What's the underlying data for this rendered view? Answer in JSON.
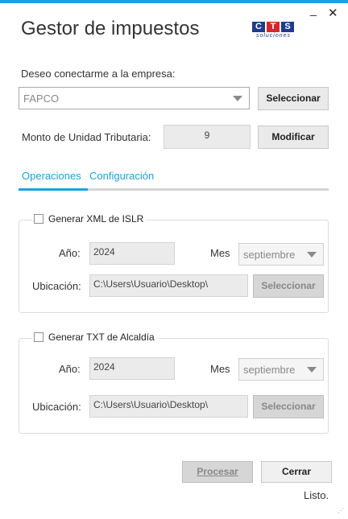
{
  "window": {
    "title": "Gestor de impuestos",
    "minimize_glyph": "_",
    "close_glyph": "✕"
  },
  "logo": {
    "letters": [
      "C",
      "T",
      "S"
    ],
    "tagline": "soluciones"
  },
  "company": {
    "label": "Deseo conectarme a la empresa:",
    "selected": "FAPCO",
    "select_button": "Seleccionar"
  },
  "unit": {
    "label": "Monto de Unidad Tributaria:",
    "value": "9",
    "modify_button": "Modificar"
  },
  "tabs": [
    {
      "label": "Operaciones",
      "active": true
    },
    {
      "label": "Configuración",
      "active": false
    }
  ],
  "xml_group": {
    "title": "Generar XML de ISLR",
    "checked": false,
    "year_label": "Año:",
    "year_value": "2024",
    "month_label": "Mes",
    "month_value": "septiembre",
    "location_label": "Ubicación:",
    "location_value": "C:\\Users\\Usuario\\Desktop\\",
    "select_button": "Seleccionar"
  },
  "txt_group": {
    "title": "Generar TXT de Alcaldía",
    "checked": false,
    "year_label": "Año:",
    "year_value": "2024",
    "month_label": "Mes",
    "month_value": "septiembre",
    "location_label": "Ubicación:",
    "location_value": "C:\\Users\\Usuario\\Desktop\\",
    "select_button": "Seleccionar"
  },
  "footer": {
    "process_button": "Procesar",
    "close_button": "Cerrar",
    "status": "Listo."
  },
  "colors": {
    "accent": "#1ba1e2",
    "logo_blue": "#1f3b8f",
    "logo_red": "#d8262e"
  }
}
